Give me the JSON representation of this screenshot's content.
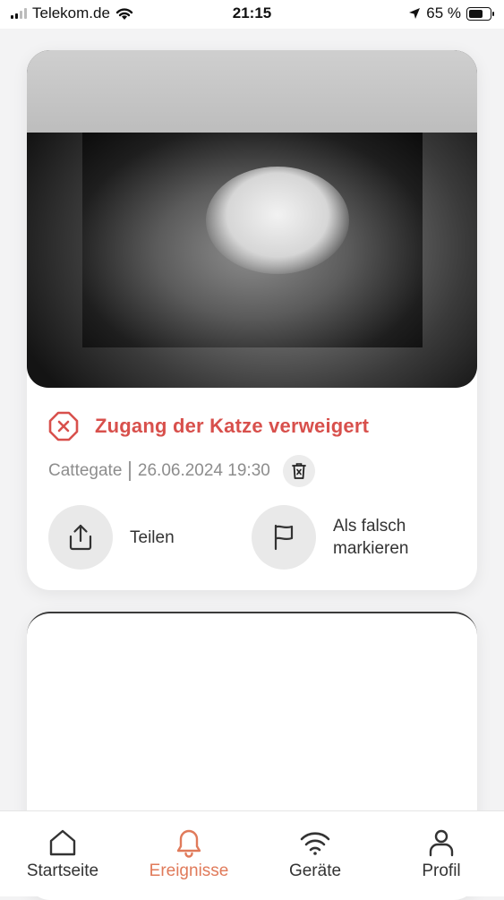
{
  "status_bar": {
    "carrier": "Telekom.de",
    "time": "21:15",
    "battery": "65 %",
    "battery_level": 0.65
  },
  "event_card": {
    "photo_description_icon": "cat-camera-photo",
    "title": "Zugang der Katze verweigert",
    "status_icon": "denied-x-circle-icon",
    "accent_color": "#d8504c",
    "device": "Cattegate",
    "datetime": "26.06.2024 19:30",
    "actions": {
      "share_label": "Teilen",
      "flag_label_line1": "Als falsch",
      "flag_label_line2": "markieren"
    }
  },
  "tabbar": {
    "active_color": "#e07a5a",
    "items": [
      {
        "label": "Startseite",
        "icon": "home-icon"
      },
      {
        "label": "Ereignisse",
        "icon": "bell-icon"
      },
      {
        "label": "Geräte",
        "icon": "wifi-icon"
      },
      {
        "label": "Profil",
        "icon": "person-icon"
      }
    ],
    "active_index": 1
  }
}
